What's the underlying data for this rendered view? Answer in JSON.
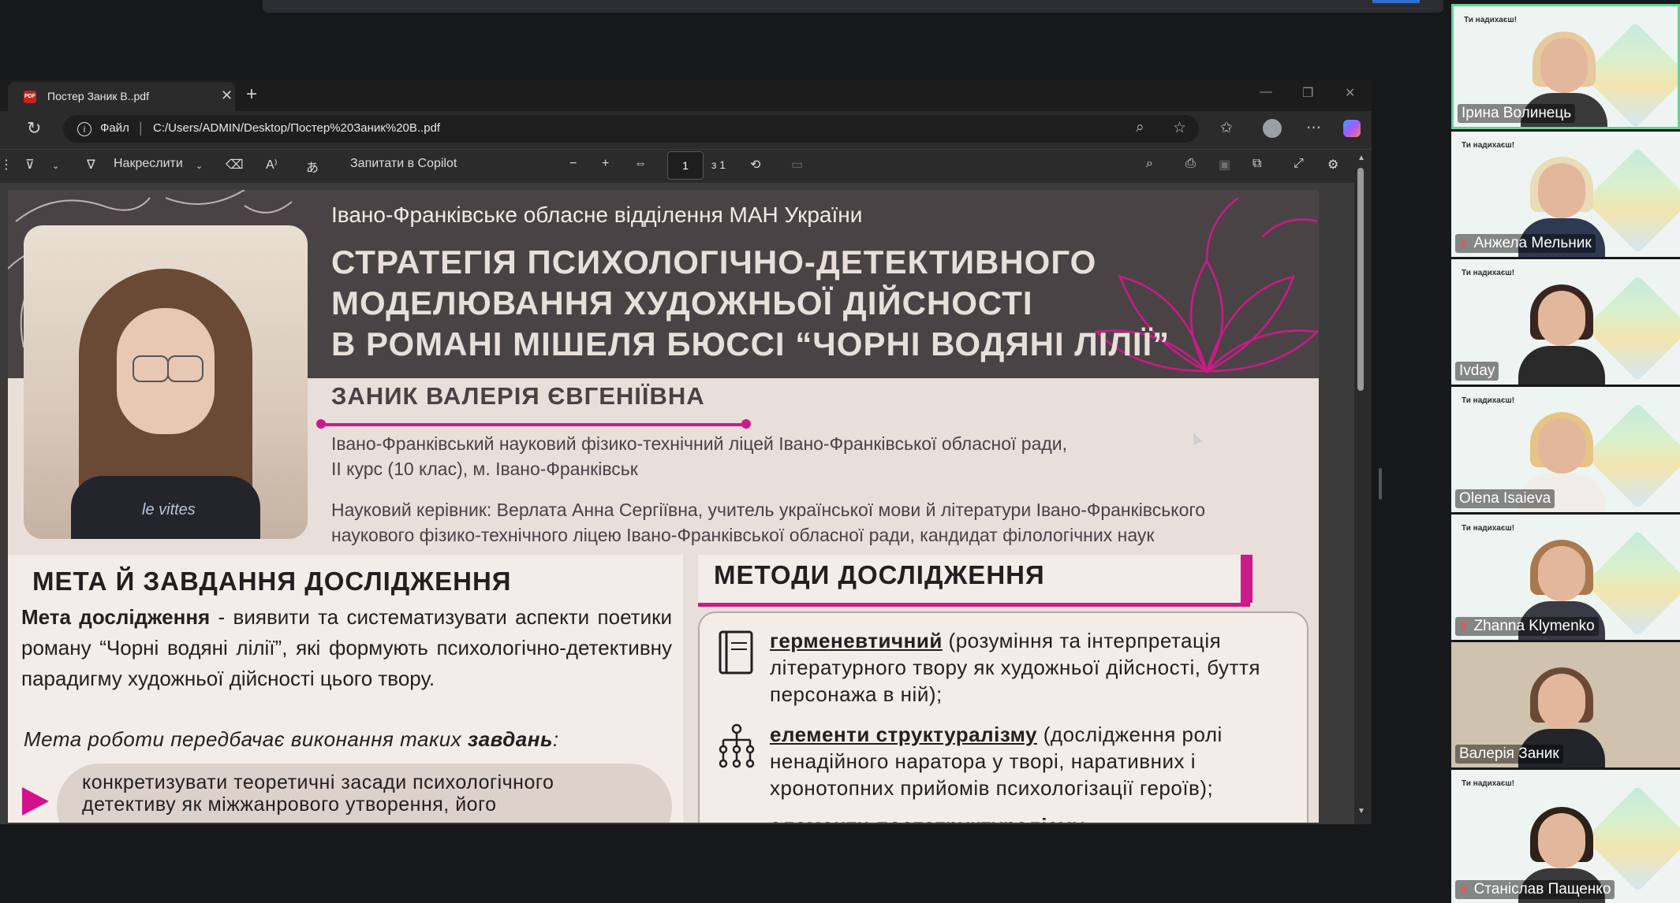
{
  "browser": {
    "tab_title": "Постер Заник В..pdf",
    "file_label": "Файл",
    "url": "C:/Users/ADMIN/Desktop/Постер%20Заник%20В..pdf"
  },
  "pdf_toolbar": {
    "draw_label": "Накреслити",
    "copilot_label": "Запитати в Copilot",
    "current_page": "1",
    "total_pages": "з 1"
  },
  "poster": {
    "org": "Івано-Франківське обласне відділення МАН України",
    "title_lines": [
      "СТРАТЕГІЯ ПСИХОЛОГІЧНО-ДЕТЕКТИВНОГО",
      "МОДЕЛЮВАННЯ ХУДОЖНЬОЇ ДІЙСНОСТІ",
      "В РОМАНІ МІШЕЛЯ БЮССІ “ЧОРНІ ВОДЯНІ ЛІЛІЇ”"
    ],
    "author": "ЗАНИК ВАЛЕРІЯ ЄВГЕНІЇВНА",
    "school_line1": "Івано-Франківський науковий фізико-технічний ліцей Івано-Франківської обласної ради,",
    "school_line2": "ІІ курс (10 клас), м. Івано-Франківськ",
    "supervisor_line1": "Науковий керівник: Верлата Анна Сергіївна, учитель української мови й літератури Івано-Франківського",
    "supervisor_line2": "наукового фізико-технічного ліцею Івано-Франківської обласної ради, кандидат філологічних наук",
    "shirt_print": "le vittes",
    "goal": {
      "heading": "МЕТА Й ЗАВДАННЯ ДОСЛІДЖЕННЯ",
      "lead": "Мета дослідження",
      "text": " - виявити та систематизувати аспекти поетики роману “Чорні водяні лілії”, які формують психологічно-детективну парадигму художньої дійсності цього твору.",
      "tasks_intro_a": "Мета роботи передбачає виконання таких ",
      "tasks_intro_b": "завдань",
      "tasks_intro_c": ":",
      "task1": "конкретизувати теоретичні засади психологічного детективу як міжжанрового утворення, його"
    },
    "methods": {
      "heading": "МЕТОДИ ДОСЛІДЖЕННЯ",
      "items": [
        {
          "term": "герменевтичний",
          "desc": " (розуміння та інтерпретація літературного твору як художньої дійсності, буття персонажа в ній);"
        },
        {
          "term": "елементи структуралізму",
          "desc": " (дослідження  ролі ненадійного наратора у творі, наративних і хронотопних прийомів психологізації героїв);"
        },
        {
          "term": "елементи постструктуралізму",
          "desc": ""
        }
      ]
    }
  },
  "participants": [
    {
      "name": "Ірина Волинець",
      "muted": false,
      "banner": "Ти надихаєш!"
    },
    {
      "name": "Анжела Мельник",
      "muted": true,
      "banner": "Ти надихаєш!"
    },
    {
      "name": "Ivday",
      "muted": false,
      "banner": "Ти надихаєш!"
    },
    {
      "name": "Olena Isaieva",
      "muted": false,
      "banner": "Ти надихаєш!"
    },
    {
      "name": "Zhanna Klymenko",
      "muted": true,
      "banner": "Ти надихаєш!"
    },
    {
      "name": "Валерія Заник",
      "muted": false,
      "banner": ""
    },
    {
      "name": "Станіслав Пащенко",
      "muted": true,
      "banner": "Ти надихаєш!"
    }
  ],
  "colors": {
    "accent_magenta": "#cc1a88",
    "poster_header": "#4a4346",
    "active_speaker": "#5fd39a"
  }
}
